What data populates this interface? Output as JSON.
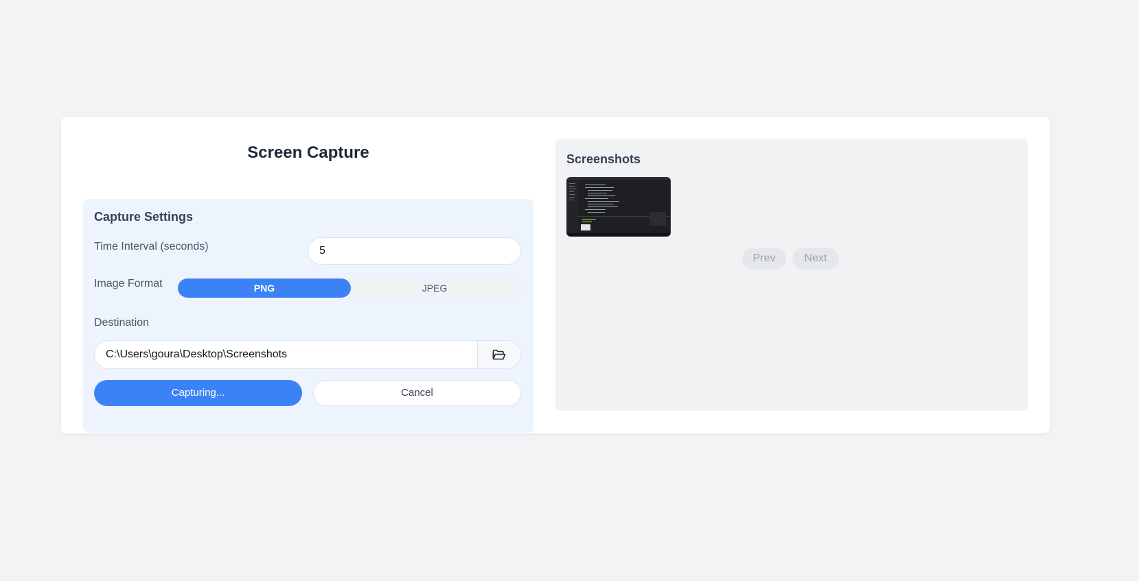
{
  "app": {
    "title": "Screen Capture"
  },
  "settings": {
    "title": "Capture Settings",
    "interval_label": "Time Interval (seconds)",
    "interval_value": "5",
    "format_label": "Image Format",
    "format_options": [
      "PNG",
      "JPEG"
    ],
    "format_selected": "PNG",
    "destination_label": "Destination",
    "destination_value": "C:\\Users\\goura\\Desktop\\Screenshots",
    "browse_icon": "folder-open-icon",
    "capture_button": "Capturing...",
    "cancel_button": "Cancel"
  },
  "screenshots": {
    "title": "Screenshots",
    "prev_label": "Prev",
    "next_label": "Next"
  },
  "colors": {
    "accent": "#3b82f6",
    "settings_bg": "#eef4fe",
    "panel_bg": "#f1f2f4"
  }
}
